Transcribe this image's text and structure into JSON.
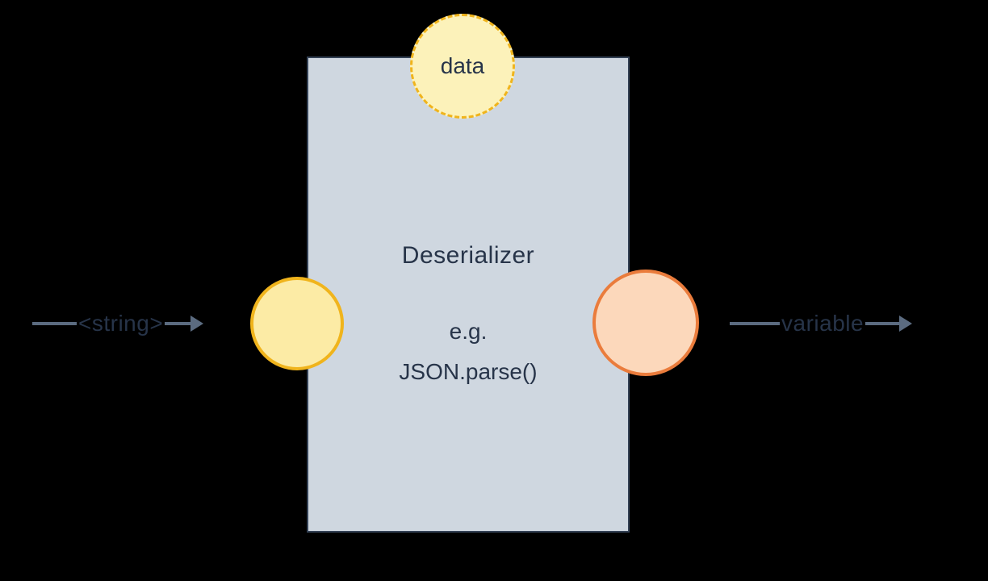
{
  "diagram": {
    "box": {
      "title": "Deserializer",
      "example_prefix": "e.g.",
      "example_code": "JSON.parse()"
    },
    "nodes": {
      "top": {
        "label": "data"
      },
      "left": {
        "label": ""
      },
      "right": {
        "label": ""
      }
    },
    "arrows": {
      "in": {
        "label": "<string>"
      },
      "out": {
        "label": "variable"
      }
    },
    "colors": {
      "box_fill": "#cfd7e0",
      "box_border": "#334155",
      "data_fill": "#fcf2ba",
      "data_border": "#f0b41c",
      "input_fill": "#fceba5",
      "input_border": "#f0b41c",
      "output_fill": "#fcd8bb",
      "output_border": "#ea7c3c",
      "arrow": "#5b6b80",
      "text": "#273449"
    }
  }
}
